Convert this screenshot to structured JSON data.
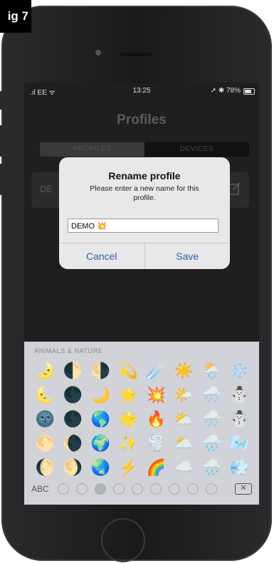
{
  "figure_label": "ig 7",
  "status_bar": {
    "carrier": ".ıl EE ᯤ",
    "time": "13:25",
    "right": "➚ ✱ 78%"
  },
  "app": {
    "title": "Profiles",
    "tabs": [
      {
        "label": "PROFILES"
      },
      {
        "label": "DEVICES"
      }
    ],
    "profile_row_label": "DE"
  },
  "dialog": {
    "title": "Rename profile",
    "message": "Please enter a new name for this profile.",
    "input_value": "DEMO 💥",
    "cancel_label": "Cancel",
    "save_label": "Save"
  },
  "keyboard": {
    "category": "ANIMALS & NATURE",
    "emojis": [
      "🌛",
      "🌓",
      "🌗",
      "💫",
      "☄️",
      "☀️",
      "🌦️",
      "❄️",
      "🌜",
      "🌑",
      "🌙",
      "⭐",
      "💥",
      "🌤️",
      "🌨️",
      "⛄",
      "🌚",
      "🌑",
      "🌎",
      "🌟",
      "🔥",
      "⛅",
      "🌨️",
      "☃️",
      "🌕",
      "🌘",
      "🌍",
      "✨",
      "🌪️",
      "🌥️",
      "🌧️",
      "🌬️",
      "🌔",
      "🌖",
      "🌏",
      "⚡",
      "🌈",
      "☁️",
      "🌧️",
      "💨"
    ],
    "abc_label": "ABC",
    "delete_label": "✕"
  }
}
